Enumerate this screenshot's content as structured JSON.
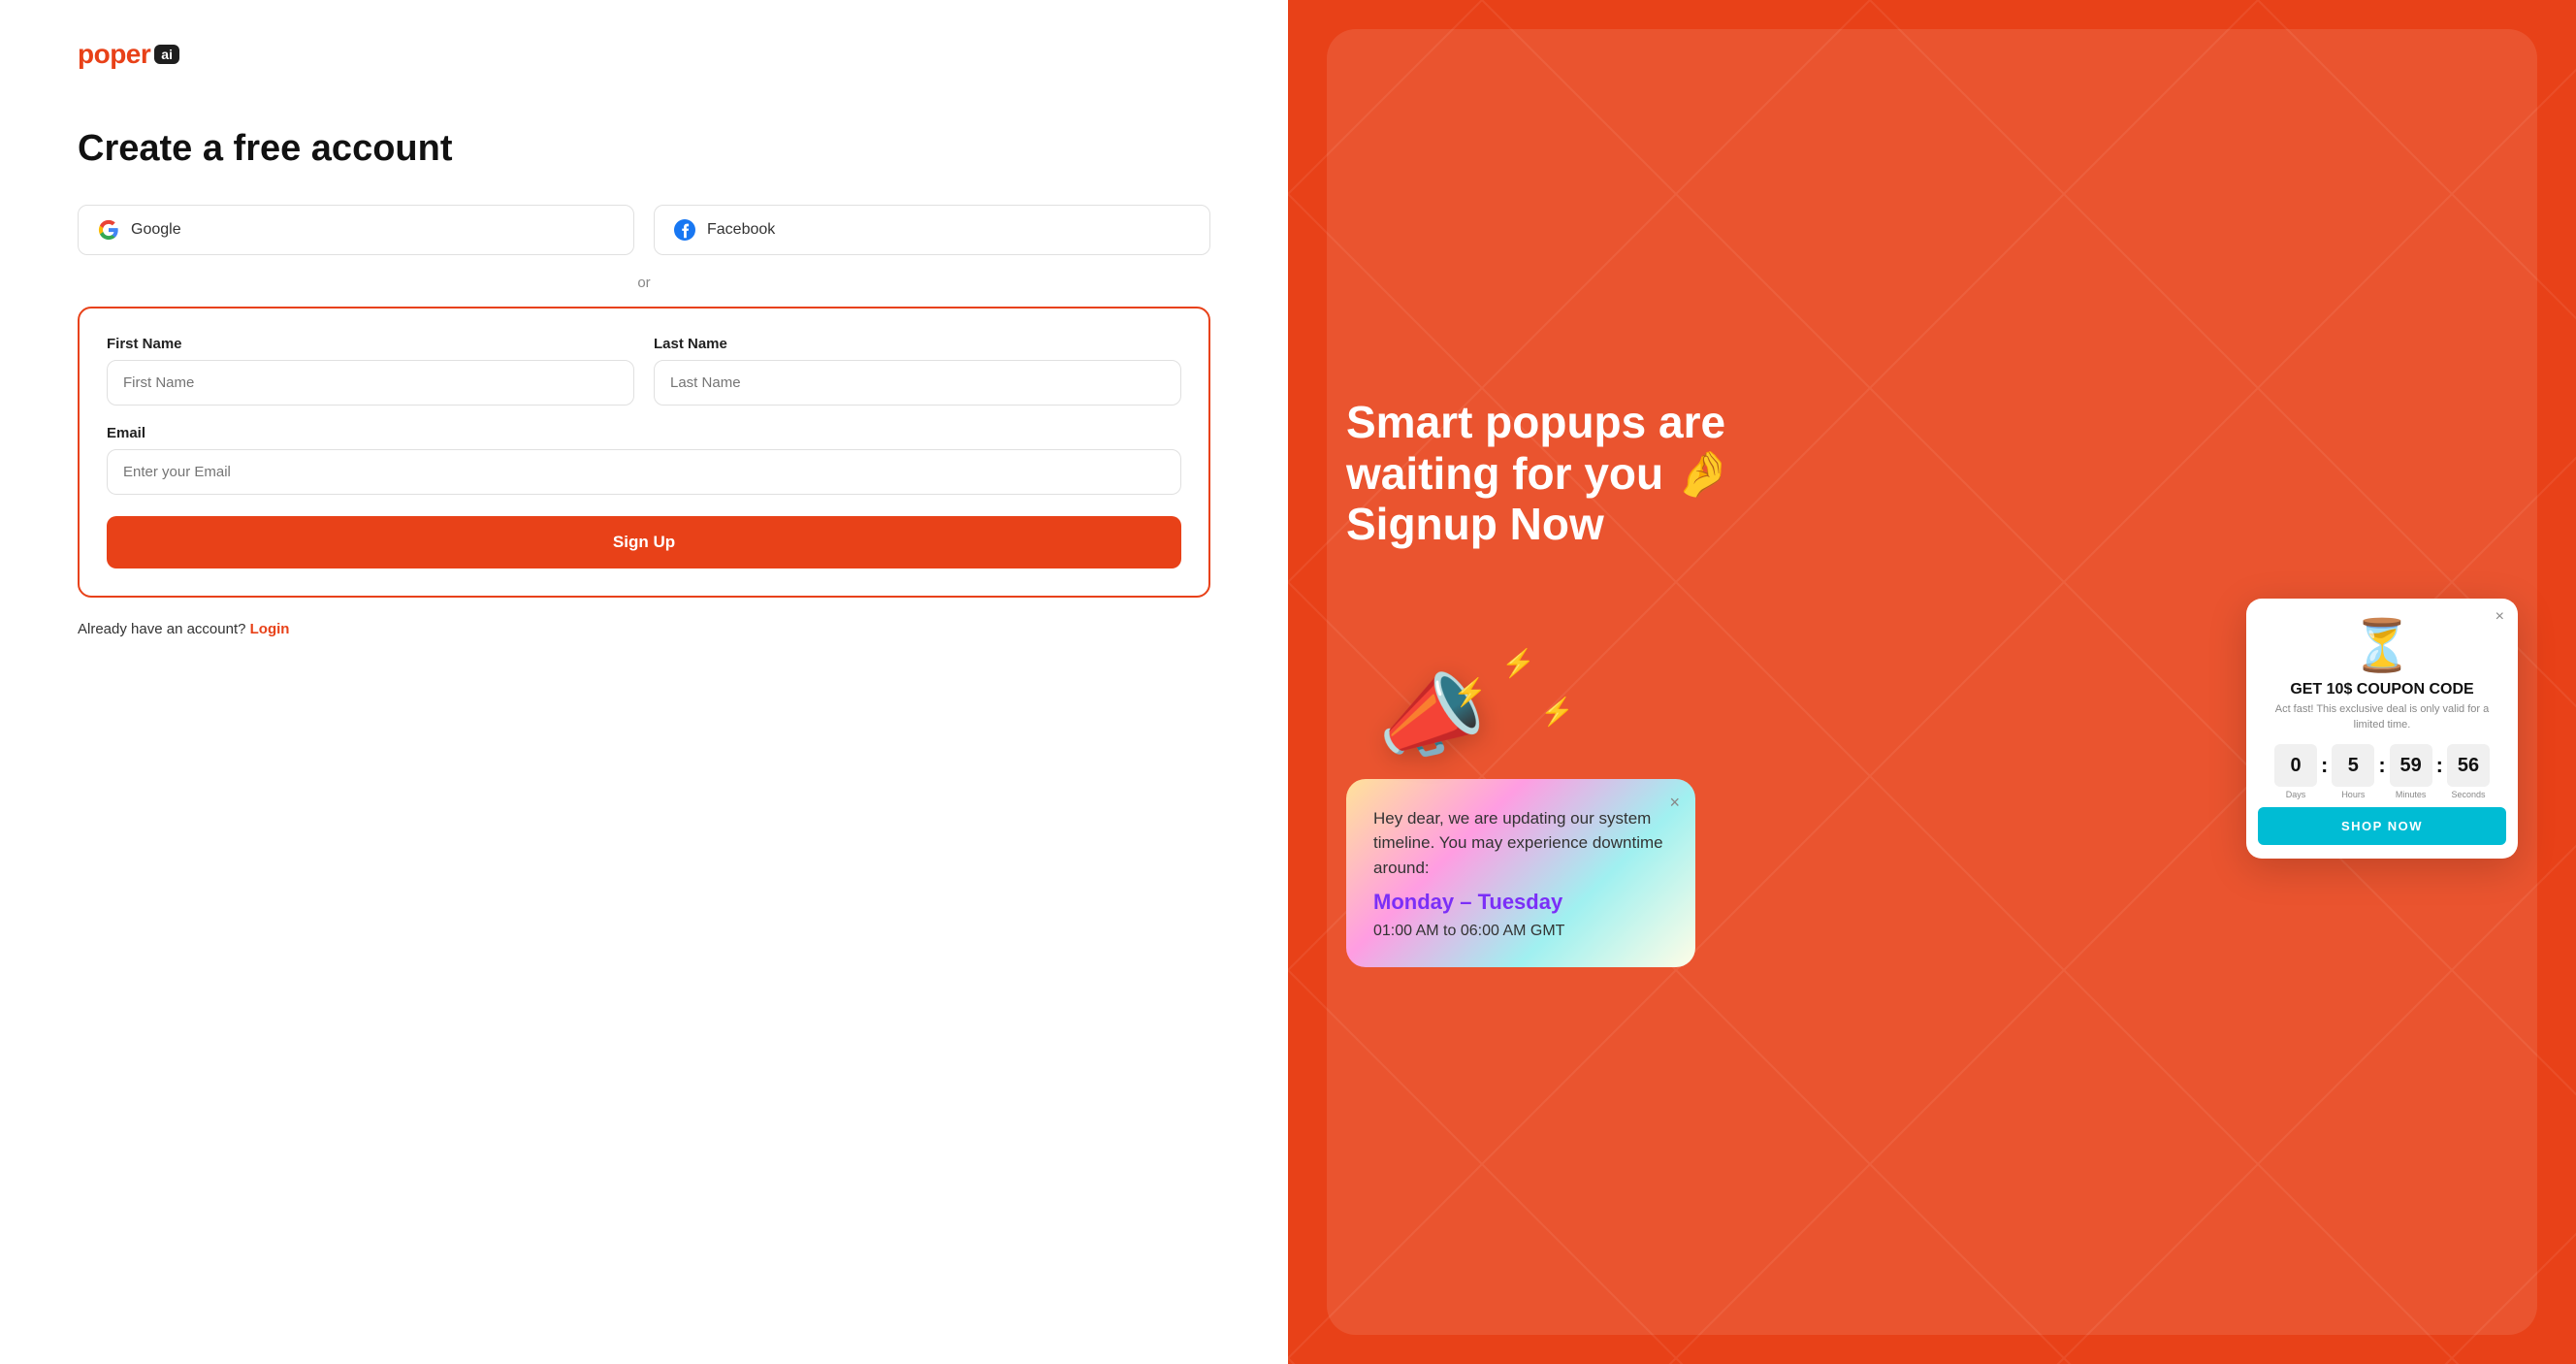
{
  "logo": {
    "brand": "poper",
    "badge": "ai"
  },
  "left": {
    "title": "Create a free account",
    "google_btn": "Google",
    "facebook_btn": "Facebook",
    "or_divider": "or",
    "form": {
      "first_name_label": "First Name",
      "first_name_placeholder": "First Name",
      "last_name_label": "Last Name",
      "last_name_placeholder": "Last Name",
      "email_label": "Email",
      "email_placeholder": "Enter your Email",
      "signup_btn": "Sign Up"
    },
    "already_account": "Already have an account?",
    "login_link": "Login"
  },
  "right": {
    "promo_title": "Smart popups are waiting for you 🤌 Signup Now",
    "notif_card": {
      "body": "Hey dear, we are updating our system timeline. You may experience downtime around:",
      "highlight": "Monday – Tuesday",
      "time": "01:00 AM to 06:00 AM GMT",
      "close": "×"
    },
    "coupon_card": {
      "close": "×",
      "title": "GET 10$ COUPON CODE",
      "subtitle": "Act fast! This exclusive deal is only valid for a limited time.",
      "countdown": {
        "days_val": "0",
        "days_label": "Days",
        "hours_val": "5",
        "hours_label": "Hours",
        "minutes_val": "59",
        "minutes_label": "Minutes",
        "seconds_val": "56",
        "seconds_label": "Seconds"
      },
      "shop_btn": "SHOP NOW"
    }
  }
}
